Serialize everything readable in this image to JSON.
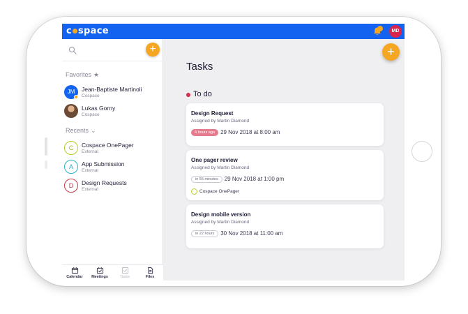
{
  "app": {
    "logo_left": "c",
    "logo_right": "space",
    "user_initials": "MD"
  },
  "sidebar": {
    "favorites_label": "Favorites",
    "favorites_symbol": "★",
    "favorites": [
      {
        "initials": "JM",
        "name": "Jean-Baptiste Martinoli",
        "org": "Cospace"
      },
      {
        "initials": "",
        "name": "Lukas Gorny",
        "org": "Cospace"
      }
    ],
    "recents_label": "Recents",
    "recents_symbol": "⌄",
    "recents": [
      {
        "letter": "C",
        "name": "Cospace OnePager",
        "type": "External"
      },
      {
        "letter": "A",
        "name": "App Submission",
        "type": "External"
      },
      {
        "letter": "D",
        "name": "Design Requests",
        "type": "External"
      }
    ],
    "add_symbol": "+"
  },
  "bottom_nav": [
    {
      "label": "Calendar",
      "icon": "calendar-icon"
    },
    {
      "label": "Meetings",
      "icon": "meetings-icon"
    },
    {
      "label": "Tasks",
      "icon": "tasks-icon"
    },
    {
      "label": "Files",
      "icon": "files-icon"
    }
  ],
  "main": {
    "title": "Tasks",
    "add_symbol": "+",
    "group_label": "To do",
    "tasks": [
      {
        "title": "Design Request",
        "assigned": "Assigned by Martin Diamond",
        "due_badge": "4 hours ago",
        "due_date": "29 Nov 2018 at 8:00 am"
      },
      {
        "title": "One pager review",
        "assigned": "Assigned by Martin Diamond",
        "due_badge": "in 55 minutes",
        "due_date": "29 Nov 2018 at 1:00 pm",
        "space": "Cospace OnePager"
      },
      {
        "title": "Design mobile version",
        "assigned": "Assigned by Martin Diamond",
        "due_badge": "in 22 hours",
        "due_date": "30 Nov 2018 at 11:00 am"
      }
    ]
  },
  "colors": {
    "brand_blue": "#1463f0",
    "accent_orange": "#f5a623",
    "overdue_pink": "#e57c8e",
    "todo_red": "#d62d52"
  }
}
